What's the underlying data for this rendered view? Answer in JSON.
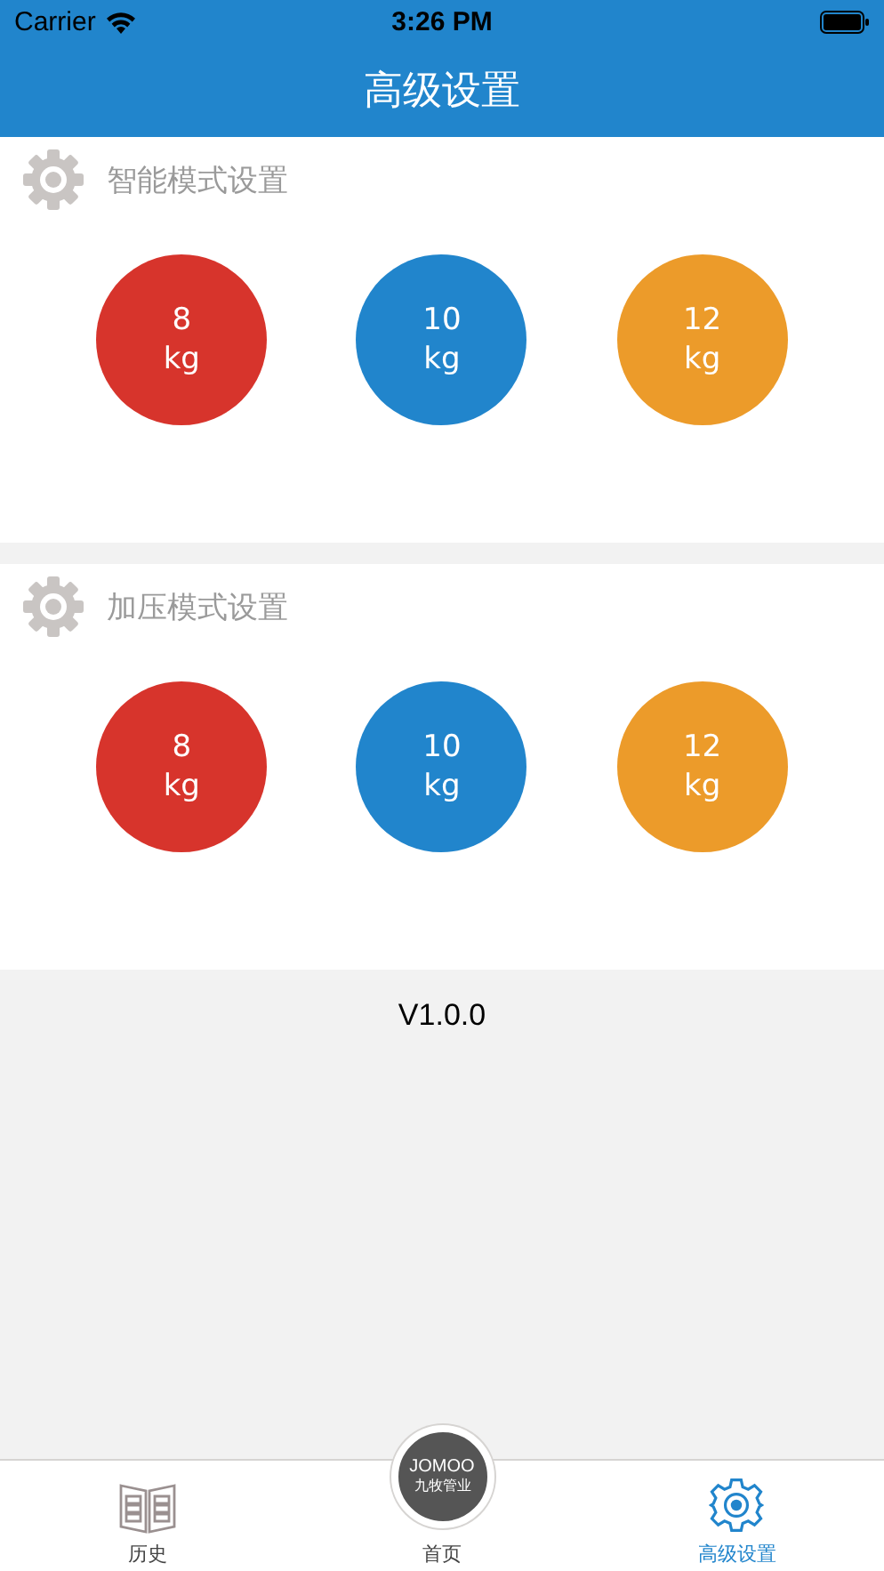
{
  "status_bar": {
    "carrier": "Carrier",
    "time": "3:26 PM"
  },
  "nav_bar": {
    "title": "高级设置"
  },
  "sections": [
    {
      "title": "智能模式设置",
      "options": [
        {
          "value": "8",
          "unit": "kg",
          "color": "#d7342c"
        },
        {
          "value": "10",
          "unit": "kg",
          "color": "#2185cc"
        },
        {
          "value": "12",
          "unit": "kg",
          "color": "#ec9b2a"
        }
      ]
    },
    {
      "title": "加压模式设置",
      "options": [
        {
          "value": "8",
          "unit": "kg",
          "color": "#d7342c"
        },
        {
          "value": "10",
          "unit": "kg",
          "color": "#2185cc"
        },
        {
          "value": "12",
          "unit": "kg",
          "color": "#ec9b2a"
        }
      ]
    }
  ],
  "version": "V1.0.0",
  "tab_bar": [
    {
      "kind": "book",
      "label": "历史",
      "selected": false
    },
    {
      "kind": "logo",
      "label": "首页",
      "logo_text": "JOMOO",
      "logo_subtext": "九牧管业",
      "selected": false
    },
    {
      "kind": "gear",
      "label": "高级设置",
      "selected": true
    }
  ]
}
